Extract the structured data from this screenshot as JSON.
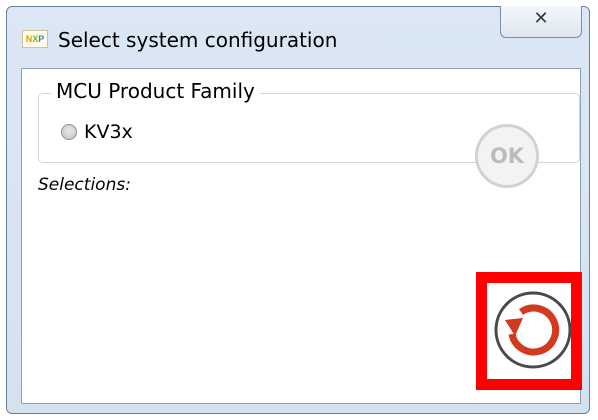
{
  "window": {
    "title": "Select system configuration",
    "app_icon": "nxp-logo-icon",
    "close_glyph": "✕"
  },
  "group": {
    "legend": "MCU Product Family",
    "options": [
      {
        "label": "KV3x",
        "selected": false
      }
    ]
  },
  "selections_label": "Selections:",
  "buttons": {
    "ok_label": "OK",
    "ok_enabled": false,
    "reset_icon": "refresh-icon"
  },
  "colors": {
    "highlight": "#ff0000",
    "reset_arrow": "#d23a1e",
    "reset_ring": "#4a4a4a"
  }
}
